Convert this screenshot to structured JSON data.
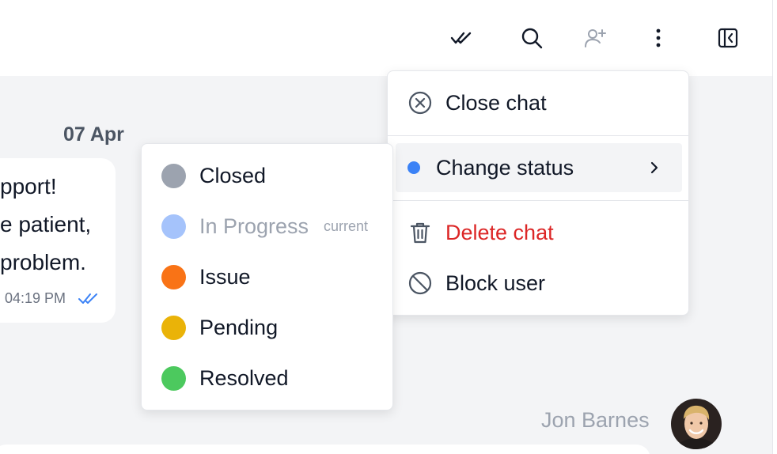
{
  "toolbar": {
    "icons": [
      "mark-read-icon",
      "search-icon",
      "add-user-icon",
      "more-vertical-icon",
      "collapse-panel-icon"
    ]
  },
  "chat": {
    "date": "07 Apr",
    "message_lines": [
      "pport!",
      "e patient,",
      "problem."
    ],
    "time": "04:19 PM",
    "sender": "Jon Barnes"
  },
  "main_menu": {
    "close_chat": "Close chat",
    "change_status": "Change status",
    "delete_chat": "Delete chat",
    "block_user": "Block user"
  },
  "status_menu": {
    "items": [
      {
        "label": "Closed",
        "color": "#9ca3af",
        "note": ""
      },
      {
        "label": "In Progress",
        "color": "#a5c3fb",
        "note": "current"
      },
      {
        "label": "Issue",
        "color": "#f97316",
        "note": ""
      },
      {
        "label": "Pending",
        "color": "#eab308",
        "note": ""
      },
      {
        "label": "Resolved",
        "color": "#4cc95e",
        "note": ""
      }
    ]
  },
  "colors": {
    "accent": "#3b82f6",
    "danger": "#dc2626"
  }
}
